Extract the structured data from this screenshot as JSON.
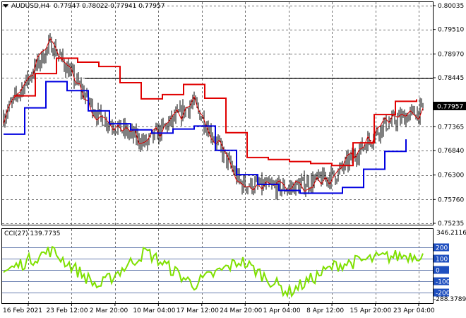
{
  "window": {
    "symbol": "AUDUSD,H4",
    "ohlc": "0.77947 0.78022 0.77941 0.77957"
  },
  "main_axis": {
    "ticks": [
      "0.80035",
      "0.79510",
      "0.78970",
      "0.78445",
      "0.77365",
      "0.76840",
      "0.76300",
      "0.75760",
      "0.75235"
    ],
    "current_price_label": "0.77957"
  },
  "cci_panel": {
    "title": "CCI(27) 139.7735",
    "top_value": "346.2116",
    "bottom_value": "-288.3789",
    "levels": [
      "200",
      "100",
      "0",
      "-100",
      "-200"
    ]
  },
  "time_axis": {
    "labels": [
      "16 Feb 2021",
      "23 Feb 12:00",
      "2 Mar 20:00",
      "10 Mar 04:00",
      "17 Mar 12:00",
      "24 Mar 20:00",
      "1 Apr 04:00",
      "8 Apr 12:00",
      "15 Apr 20:00",
      "23 Apr 04:00"
    ]
  },
  "colors": {
    "price": "#000000",
    "red_line": "#e00000",
    "blue_line": "#0000e0",
    "resistance": "#000000",
    "cci_line": "#7fe000",
    "level_tag_bg": "#1f4fbf",
    "grid": "#000000"
  },
  "chart_data": [
    {
      "type": "line",
      "title": "",
      "ylim": [
        0.75235,
        0.80035
      ],
      "x": [
        "16 Feb 2021",
        "23 Feb 12:00",
        "2 Mar 20:00",
        "10 Mar 04:00",
        "17 Mar 12:00",
        "24 Mar 20:00",
        "1 Apr 04:00",
        "8 Apr 12:00",
        "15 Apr 20:00",
        "23 Apr 04:00"
      ],
      "series": [
        {
          "name": "",
          "values": [
            0.776,
            0.792,
            0.776,
            0.77,
            0.779,
            0.761,
            0.76,
            0.763,
            0.774,
            0.778
          ]
        },
        {
          "name": "",
          "values": [
            0.778,
            0.789,
            0.787,
            0.779,
            0.784,
            0.767,
            0.766,
            0.765,
            0.779,
            0.78
          ]
        },
        {
          "name": "",
          "values": [
            0.772,
            0.785,
            0.775,
            0.772,
            0.774,
            0.762,
            0.759,
            0.759,
            0.768,
            0.774
          ]
        }
      ],
      "hlines": [
        0.7843
      ],
      "grid": true
    },
    {
      "type": "line",
      "title": "",
      "ylim": [
        -288.3789,
        346.2116
      ],
      "x": [
        "16 Feb 2021",
        "23 Feb 12:00",
        "2 Mar 20:00",
        "10 Mar 04:00",
        "17 Mar 12:00",
        "24 Mar 20:00",
        "1 Apr 04:00",
        "8 Apr 12:00",
        "15 Apr 20:00",
        "23 Apr 04:00"
      ],
      "series": [
        {
          "name": "",
          "values": [
            -20,
            170,
            -150,
            160,
            -130,
            80,
            -200,
            40,
            110,
            140
          ]
        }
      ],
      "levels": [
        200,
        100,
        0,
        -100,
        -200
      ],
      "grid": true
    }
  ]
}
